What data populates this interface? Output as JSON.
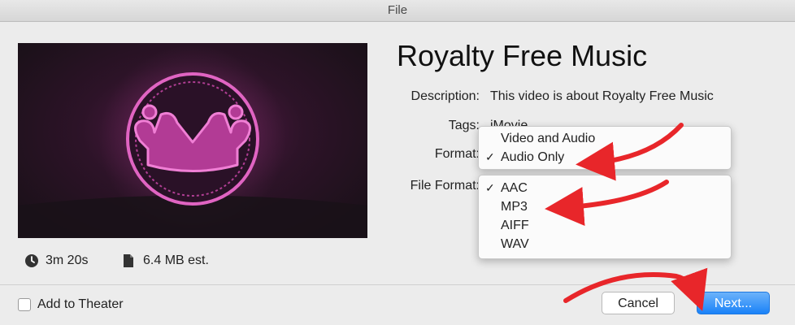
{
  "window": {
    "title": "File"
  },
  "project": {
    "title": "Royalty Free Music",
    "duration": "3m 20s",
    "size": "6.4 MB est."
  },
  "fields": {
    "description_label": "Description:",
    "description_value": "This video is about Royalty Free Music",
    "tags_label": "Tags:",
    "tags_value": "iMovie",
    "format_label": "Format:",
    "file_format_label": "File Format:"
  },
  "format_menu": {
    "items": [
      {
        "label": "Video and Audio",
        "checked": false
      },
      {
        "label": "Audio Only",
        "checked": true
      }
    ]
  },
  "file_format_menu": {
    "items": [
      {
        "label": "AAC",
        "checked": true
      },
      {
        "label": "MP3",
        "checked": false
      },
      {
        "label": "AIFF",
        "checked": false
      },
      {
        "label": "WAV",
        "checked": false
      }
    ]
  },
  "footer": {
    "add_to_theater_label": "Add to Theater",
    "add_to_theater_checked": false,
    "cancel_label": "Cancel",
    "next_label": "Next..."
  },
  "colors": {
    "annotation_arrow": "#e8262a",
    "primary_button": "#1a82f8",
    "thumbnail_accent": "#c0479f"
  },
  "icons": {
    "duration": "clock-icon",
    "size": "document-icon",
    "check": "checkmark-icon"
  }
}
